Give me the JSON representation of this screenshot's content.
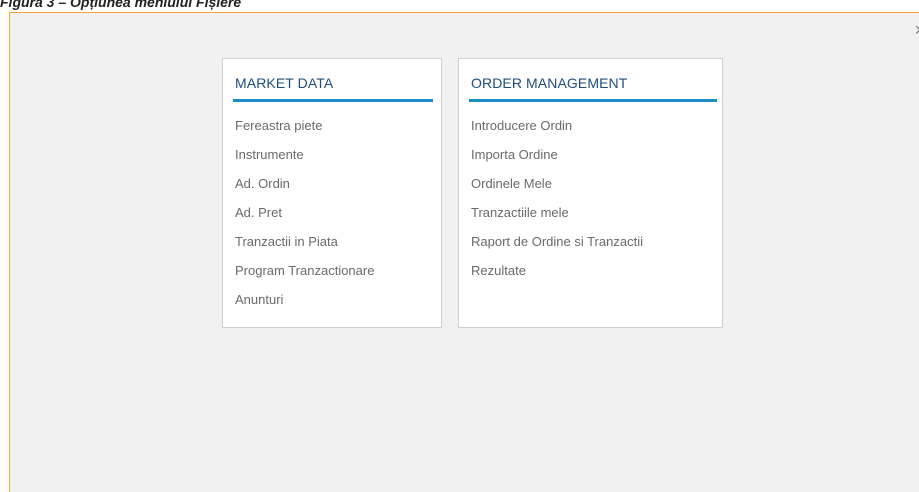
{
  "caption": "Figura 3 – Opțiunea meniului Fișiere",
  "dialog": {
    "close_label": "×"
  },
  "market_data": {
    "title": "MARKET DATA",
    "items": [
      "Fereastra piete",
      "Instrumente",
      "Ad. Ordin",
      "Ad. Pret",
      "Tranzactii in Piata",
      "Program Tranzactionare",
      "Anunturi"
    ]
  },
  "order_management": {
    "title": "ORDER MANAGEMENT",
    "items": [
      "Introducere Ordin",
      "Importa Ordine",
      "Ordinele Mele",
      "Tranzactiile mele",
      "Raport de Ordine si Tranzactii",
      "Rezultate"
    ]
  },
  "colors": {
    "accent_border": "#f0a733",
    "title_text": "#1f4d7a",
    "underline": "#1a8fc4",
    "panel_bg": "#f1f1f1"
  }
}
